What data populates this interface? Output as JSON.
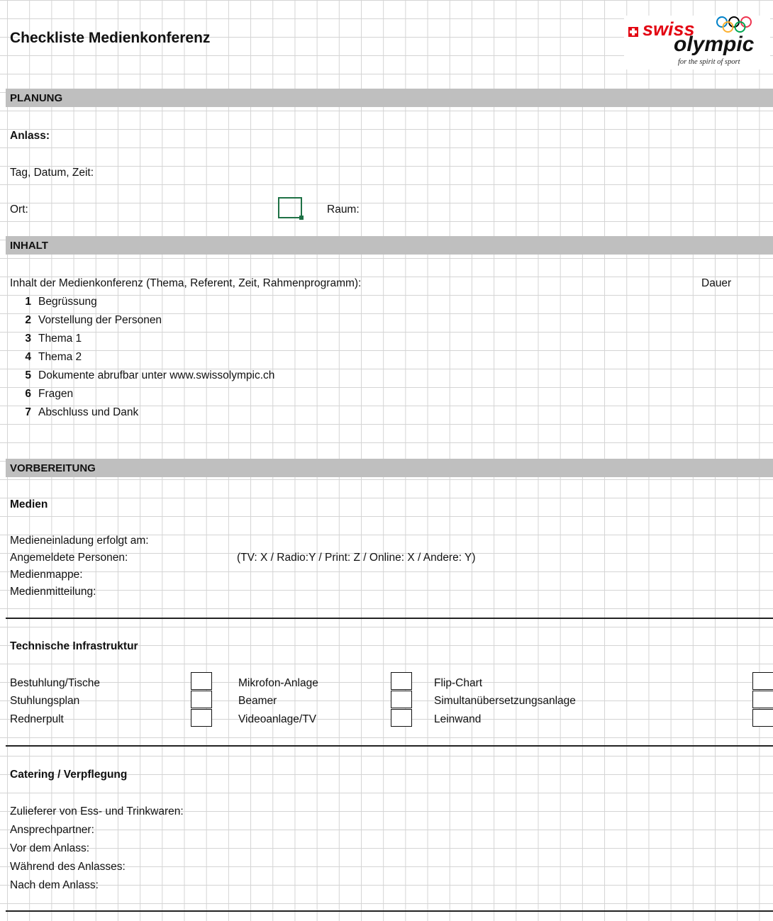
{
  "title": "Checkliste Medienkonferenz",
  "logo": {
    "brand_word1": "swiss",
    "brand_word2": "olympic",
    "tagline": "for the spirit of sport"
  },
  "sections": {
    "planung": "PLANUNG",
    "inhalt": "INHALT",
    "vorbereitung": "VORBEREITUNG"
  },
  "planung": {
    "anlass": "Anlass:",
    "tag": "Tag, Datum, Zeit:",
    "ort": "Ort:",
    "raum": "Raum:"
  },
  "inhalt": {
    "header": "Inhalt der Medienkonferenz (Thema, Referent, Zeit, Rahmenprogramm):",
    "dauer": "Dauer",
    "items": [
      {
        "num": "1",
        "text": "Begrüssung"
      },
      {
        "num": "2",
        "text": "Vorstellung der Personen"
      },
      {
        "num": "3",
        "text": "Thema 1"
      },
      {
        "num": "4",
        "text": "Thema 2"
      },
      {
        "num": "5",
        "text": "Dokumente abrufbar unter www.swissolympic.ch"
      },
      {
        "num": "6",
        "text": "Fragen"
      },
      {
        "num": "7",
        "text": "Abschluss und Dank"
      }
    ]
  },
  "medien": {
    "heading": "Medien",
    "einladung": "Medieneinladung erfolgt am:",
    "angemeldet": "Angemeldete Personen:",
    "angemeldet_hint": "(TV: X / Radio:Y / Print: Z / Online: X / Andere: Y)",
    "mappe": "Medienmappe:",
    "mitteilung": "Medienmitteilung:"
  },
  "technik": {
    "heading": "Technische Infrastruktur",
    "col1": [
      "Bestuhlung/Tische",
      "Stuhlungsplan",
      "Rednerpult"
    ],
    "col2": [
      "Mikrofon-Anlage",
      "Beamer",
      "Videoanlage/TV"
    ],
    "col3": [
      "Flip-Chart",
      "Simultanübersetzungsanlage",
      "Leinwand"
    ]
  },
  "catering": {
    "heading": "Catering / Verpflegung",
    "zulieferer": "Zulieferer von Ess- und Trinkwaren:",
    "ansprech": "Ansprechpartner:",
    "vor": "Vor dem Anlass:",
    "waehrend": "Während des Anlasses:",
    "nach": "Nach dem Anlass:"
  },
  "colors": {
    "selection": "#1e7145",
    "band": "#bfbfbf",
    "brand_red": "#e30613"
  }
}
